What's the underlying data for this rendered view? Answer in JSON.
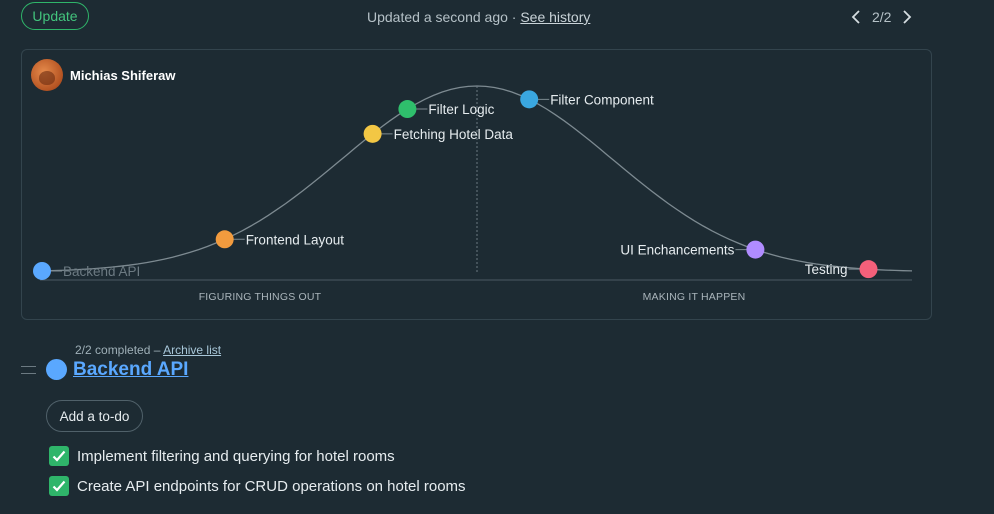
{
  "header": {
    "update_label": "Update",
    "updated_text": "Updated a second ago · ",
    "history_link": "See history",
    "pager": "2/2"
  },
  "card": {
    "owner": "Michias Shiferaw",
    "left_phase": "FIGURING THINGS OUT",
    "right_phase": "MAKING IT HAPPEN",
    "points": [
      {
        "label": "Backend API",
        "progress": 0,
        "color": "#5aa8ff",
        "dimmed": true,
        "side": "right"
      },
      {
        "label": "Frontend Layout",
        "progress": 21,
        "color": "#f29b3e",
        "dimmed": false,
        "side": "right"
      },
      {
        "label": "Fetching Hotel Data",
        "progress": 38,
        "color": "#f3c744",
        "dimmed": false,
        "side": "right"
      },
      {
        "label": "Filter Logic",
        "progress": 42,
        "color": "#2fbf6c",
        "dimmed": false,
        "side": "right"
      },
      {
        "label": "Filter Component",
        "progress": 56,
        "color": "#3aa7e0",
        "dimmed": false,
        "side": "right"
      },
      {
        "label": "UI Enchancements",
        "progress": 82,
        "color": "#b08cff",
        "dimmed": false,
        "side": "left"
      },
      {
        "label": "Testing",
        "progress": 95,
        "color": "#f4607a",
        "dimmed": false,
        "side": "left"
      }
    ]
  },
  "list": {
    "completed_text": "2/2 completed – ",
    "archive_link": "Archive list",
    "title": "Backend API",
    "color": "#5aa8ff",
    "add_label": "Add a to-do",
    "todos": [
      {
        "text": "Implement filtering and querying for hotel rooms",
        "done": true
      },
      {
        "text": "Create API endpoints for CRUD operations on hotel rooms",
        "done": true
      }
    ]
  }
}
